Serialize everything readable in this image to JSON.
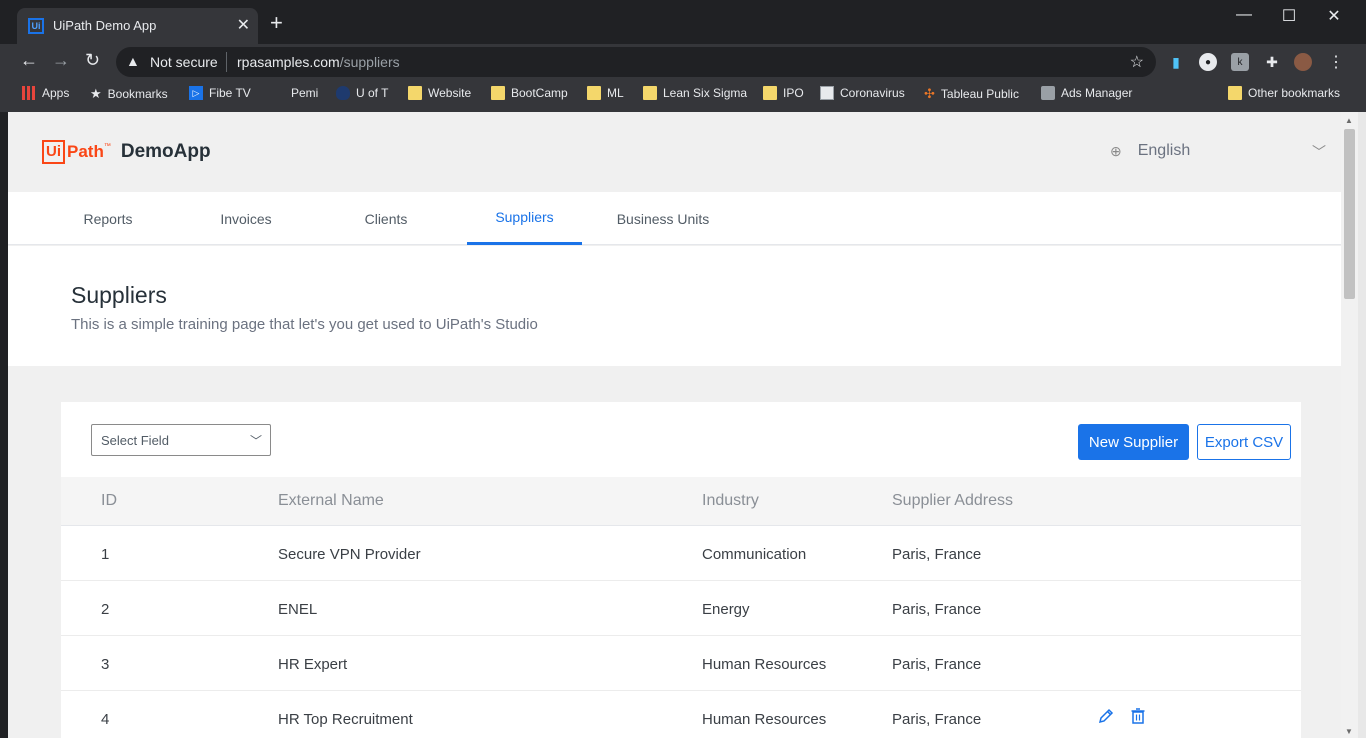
{
  "browser": {
    "tab_title": "UiPath Demo App",
    "tab_favicon_text": "Ui",
    "omnibox": {
      "security_label": "Not secure",
      "url_host": "rpasamples.com",
      "url_path": "/suppliers"
    },
    "bookmarks": [
      {
        "label": "Apps",
        "icon": "apps-grid-icon"
      },
      {
        "label": "Bookmarks",
        "icon": "star-icon"
      },
      {
        "label": "Fibe TV",
        "icon": "play-icon"
      },
      {
        "label": "Pemi",
        "icon": "blank-icon"
      },
      {
        "label": "U of T",
        "icon": "shield-icon"
      },
      {
        "label": "Website",
        "icon": "folder-icon"
      },
      {
        "label": "BootCamp",
        "icon": "folder-icon"
      },
      {
        "label": "ML",
        "icon": "folder-icon"
      },
      {
        "label": "Lean Six Sigma",
        "icon": "folder-icon"
      },
      {
        "label": "IPO",
        "icon": "folder-icon"
      },
      {
        "label": "Coronavirus",
        "icon": "news-icon"
      },
      {
        "label": "Tableau Public",
        "icon": "tableau-icon"
      },
      {
        "label": "Ads Manager",
        "icon": "ads-icon"
      }
    ],
    "other_bookmarks": "Other bookmarks"
  },
  "app": {
    "logo_ui": "Ui",
    "logo_path": "Path",
    "logo_tm": "™",
    "app_name": "DemoApp",
    "language": "English"
  },
  "nav_tabs": [
    {
      "label": "Reports",
      "active": false
    },
    {
      "label": "Invoices",
      "active": false
    },
    {
      "label": "Clients",
      "active": false
    },
    {
      "label": "Suppliers",
      "active": true
    },
    {
      "label": "Business Units",
      "active": false
    }
  ],
  "intro": {
    "title": "Suppliers",
    "subtitle": "This is a simple training page that let's you get used to UiPath's Studio"
  },
  "toolbar": {
    "select_placeholder": "Select Field",
    "new_button": "New Supplier",
    "export_button": "Export CSV"
  },
  "table": {
    "headers": [
      "ID",
      "External Name",
      "Industry",
      "Supplier Address"
    ],
    "rows": [
      [
        "1",
        "Secure VPN Provider",
        "Communication",
        "Paris, France"
      ],
      [
        "2",
        "ENEL",
        "Energy",
        "Paris, France"
      ],
      [
        "3",
        "HR Expert",
        "Human Resources",
        "Paris, France"
      ],
      [
        "4",
        "HR Top Recruitment",
        "Human Resources",
        "Paris, France"
      ]
    ]
  },
  "colors": {
    "accent": "#1a73e8",
    "brand": "#fa4616",
    "chrome_dark": "#202124",
    "chrome_mid": "#35363a"
  }
}
